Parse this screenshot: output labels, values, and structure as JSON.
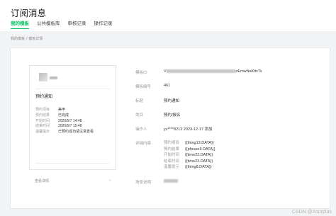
{
  "header": {
    "title": "订阅消息",
    "tabs": [
      {
        "label": "我的模板",
        "active": true
      },
      {
        "label": "公共模板库",
        "active": false
      },
      {
        "label": "审核记录",
        "active": false
      },
      {
        "label": "操作记录",
        "active": false
      }
    ]
  },
  "breadcrumb": {
    "items": [
      "我的模板",
      "模板详情"
    ],
    "separator": "/"
  },
  "preview": {
    "title": "预约通知",
    "fields": [
      {
        "key": "预约项目",
        "value": "美甲"
      },
      {
        "key": "预约结果",
        "value": "已完成"
      },
      {
        "key": "开始时间",
        "value": "2020/5/7 14:48"
      },
      {
        "key": "结束时间",
        "value": "2020/5/7 15:48"
      },
      {
        "key": "温馨提示",
        "value": "已预约成功请注意查看"
      }
    ],
    "footer_label": "查看详情",
    "footer_chevron": "›"
  },
  "details": {
    "template_id": {
      "label": "模板ID",
      "prefix": "V",
      "suffix": "zEmwNaKttcTs"
    },
    "template_no": {
      "label": "模板编号",
      "value": "461"
    },
    "title": {
      "label": "标题",
      "value": "预约通知"
    },
    "category": {
      "label": "类目",
      "value": "预约/报名"
    },
    "operator": {
      "label": "操作人",
      "value": "yz****8213 2023-12-17 添加"
    },
    "content": {
      "label": "详细内容",
      "rows": [
        {
          "key": "预约项目",
          "value": "{{thing13.DATA}}"
        },
        {
          "key": "预约结果",
          "value": "{{phrase9.DATA}}"
        },
        {
          "key": "开始时间",
          "value": "{{time22.DATA}}"
        },
        {
          "key": "结束时间",
          "value": "{{time23.DATA}}"
        },
        {
          "key": "温馨提示",
          "value": "{{thing8.DATA}}"
        }
      ]
    },
    "scene": {
      "label": "场景说明"
    }
  },
  "watermark": "CSDN @Asurplus",
  "colors": {
    "accent": "#07c160",
    "page_bg": "#f2f3f5",
    "panel_bg": "#ffffff"
  }
}
